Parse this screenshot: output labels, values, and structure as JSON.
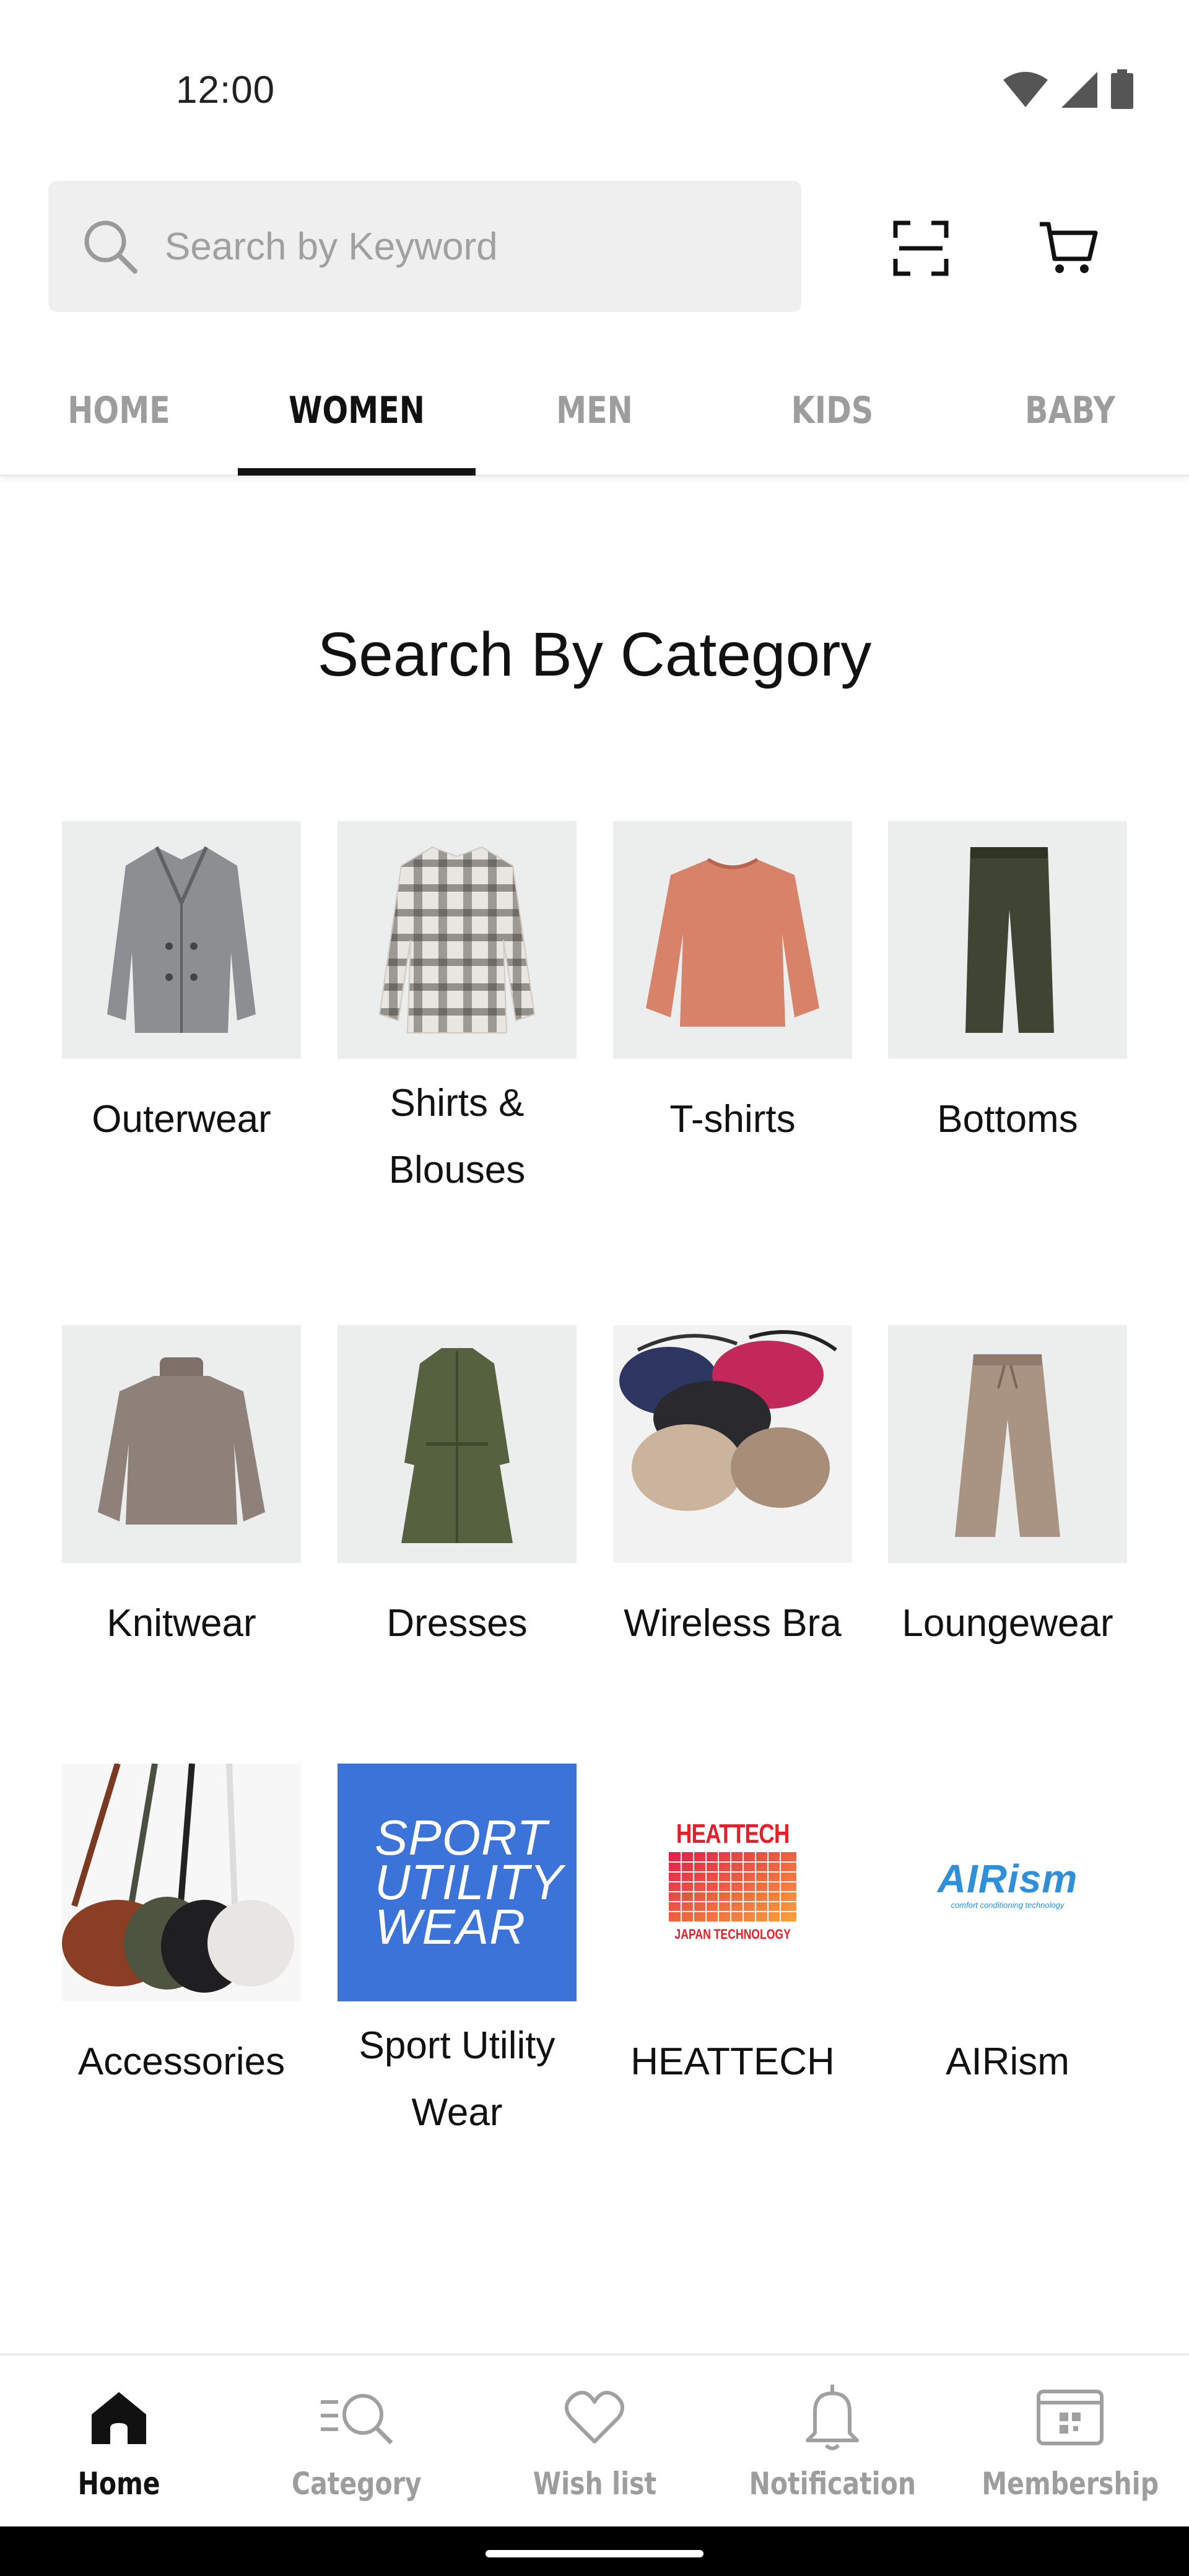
{
  "status_bar": {
    "time": "12:00"
  },
  "search": {
    "placeholder": "Search by Keyword"
  },
  "tabs": [
    {
      "label": "HOME",
      "active": false
    },
    {
      "label": "WOMEN",
      "active": true
    },
    {
      "label": "MEN",
      "active": false
    },
    {
      "label": "KIDS",
      "active": false
    },
    {
      "label": "BABY",
      "active": false
    }
  ],
  "section_title": "Search By Category",
  "categories": [
    {
      "label": "Outerwear",
      "image": "coat-image"
    },
    {
      "label": "Shirts & Blouses",
      "image": "plaid-shirt-image"
    },
    {
      "label": "T-shirts",
      "image": "sweatshirt-image"
    },
    {
      "label": "Bottoms",
      "image": "trousers-image"
    },
    {
      "label": "Knitwear",
      "image": "turtleneck-image"
    },
    {
      "label": "Dresses",
      "image": "shirt-dress-image"
    },
    {
      "label": "Wireless Bra",
      "image": "bras-image"
    },
    {
      "label": "Loungewear",
      "image": "lounge-pants-image"
    },
    {
      "label": "Accessories",
      "image": "shoulder-bags-image"
    },
    {
      "label": "Sport Utility Wear",
      "image": "sport-utility-wear-logo",
      "logo_text": [
        "SPORT",
        "UTILITY",
        "WEAR"
      ],
      "logo_bg": "#3b73d8"
    },
    {
      "label": "HEATTECH",
      "image": "heattech-logo",
      "logo_text": [
        "HEATTECH",
        "JAPAN TECHNOLOGY"
      ],
      "logo_color": "#e5202b"
    },
    {
      "label": "AIRism",
      "image": "airism-logo",
      "logo_text": [
        "AIRism",
        "comfort conditioning technology"
      ],
      "logo_color": "#2f8fd9"
    }
  ],
  "bottom_nav": [
    {
      "label": "Home",
      "icon": "home-icon",
      "active": true
    },
    {
      "label": "Category",
      "icon": "category-search-icon",
      "active": false
    },
    {
      "label": "Wish list",
      "icon": "heart-icon",
      "active": false
    },
    {
      "label": "Notification",
      "icon": "bell-icon",
      "active": false
    },
    {
      "label": "Membership",
      "icon": "membership-card-icon",
      "active": false
    }
  ],
  "colors": {
    "active_text": "#111111",
    "inactive_text": "#9d9d9d",
    "search_bg": "#efefef",
    "thumb_bg": "#eceded"
  }
}
